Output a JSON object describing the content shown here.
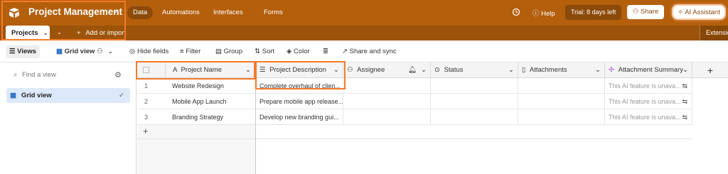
{
  "header": {
    "base_name": "Project Management",
    "nav": [
      "Data",
      "Automations",
      "Interfaces",
      "Forms"
    ],
    "help": "Help",
    "trial": "Trial: 8 days left",
    "share": "Share",
    "ai_assistant": "AI Assistant",
    "colors": {
      "header_bg": "#b35f0c",
      "highlight": "#f37b2b"
    }
  },
  "tabs": {
    "active_table": "Projects",
    "add_import": "Add or import",
    "extensions": "Extensio"
  },
  "toolbar": {
    "views": "Views",
    "grid_view": "Grid view",
    "hide_fields": "Hide fields",
    "filter": "Filter",
    "group": "Group",
    "sort": "Sort",
    "color": "Color",
    "share_sync": "Share and sync"
  },
  "sidebar": {
    "search_placeholder": "Find a view",
    "views": [
      {
        "label": "Grid view",
        "selected": true
      }
    ]
  },
  "grid": {
    "columns": [
      {
        "name": "Project Name",
        "icon": "text-icon"
      },
      {
        "name": "Project Description",
        "icon": "long-text-icon"
      },
      {
        "name": "Assignee",
        "icon": "user-icon"
      },
      {
        "name": "Status",
        "icon": "status-icon"
      },
      {
        "name": "Attachments",
        "icon": "file-icon"
      },
      {
        "name": "Attachment Summary",
        "icon": "ai-sparkle-icon"
      }
    ],
    "rows": [
      {
        "num": "1",
        "name": "Website Redesign",
        "description": "Complete overhaul of clien...",
        "assignee": "",
        "status": "",
        "attachments": "",
        "summary": "This AI feature is unava..."
      },
      {
        "num": "2",
        "name": "Mobile App Launch",
        "description": "Prepare mobile app release...",
        "assignee": "",
        "status": "",
        "attachments": "",
        "summary": "This AI feature is unava..."
      },
      {
        "num": "3",
        "name": "Branding Strategy",
        "description": "Develop new branding gui...",
        "assignee": "",
        "status": "",
        "attachments": "",
        "summary": "This AI feature is unava..."
      }
    ],
    "add_row": "+"
  }
}
